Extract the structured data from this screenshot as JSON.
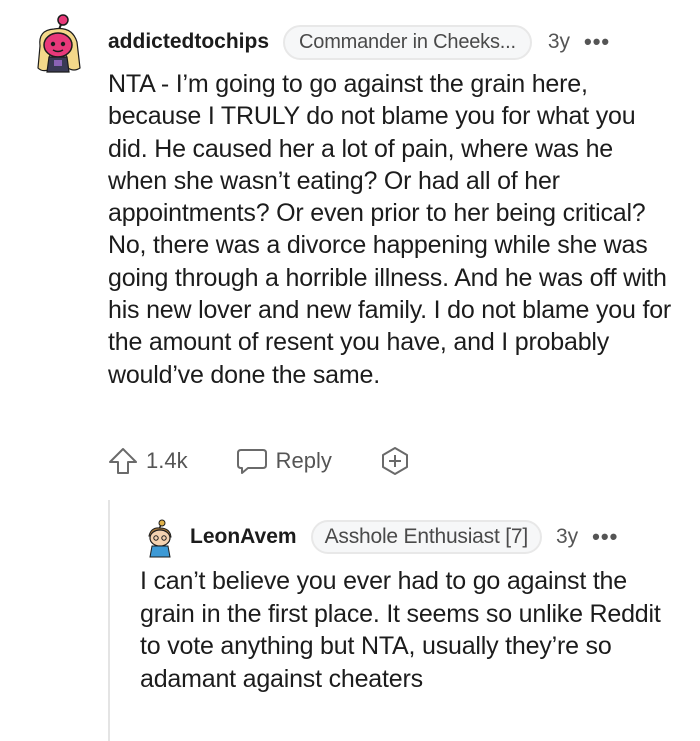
{
  "comments": [
    {
      "username": "addictedtochips",
      "flair": "Commander in Cheeks...",
      "age": "3y",
      "more": "•••",
      "body": "NTA - I’m going to go against the grain here, because I TRULY do not blame you for what you did. He caused her a lot of pain, where was he when she wasn’t eating? Or had all of her appointments? Or even prior to her being critical? No, there was a divorce happening while she was going through a horrible illness. And he was off with his new lover and new family. I do not blame you for the amount of resent you have, and I probably would’ve done the same.",
      "score": "1.4k",
      "reply_label": "Reply",
      "colors": {
        "avatar_head": "#e8397a",
        "avatar_hair": "#f3d88a"
      }
    },
    {
      "username": "LeonAvem",
      "flair": "Asshole Enthusiast [7]",
      "age": "3y",
      "more": "•••",
      "body": "I can’t believe you ever had to go against the grain in the first place. It seems so unlike Reddit to vote anything but NTA, usually they’re so adamant against cheaters"
    }
  ]
}
